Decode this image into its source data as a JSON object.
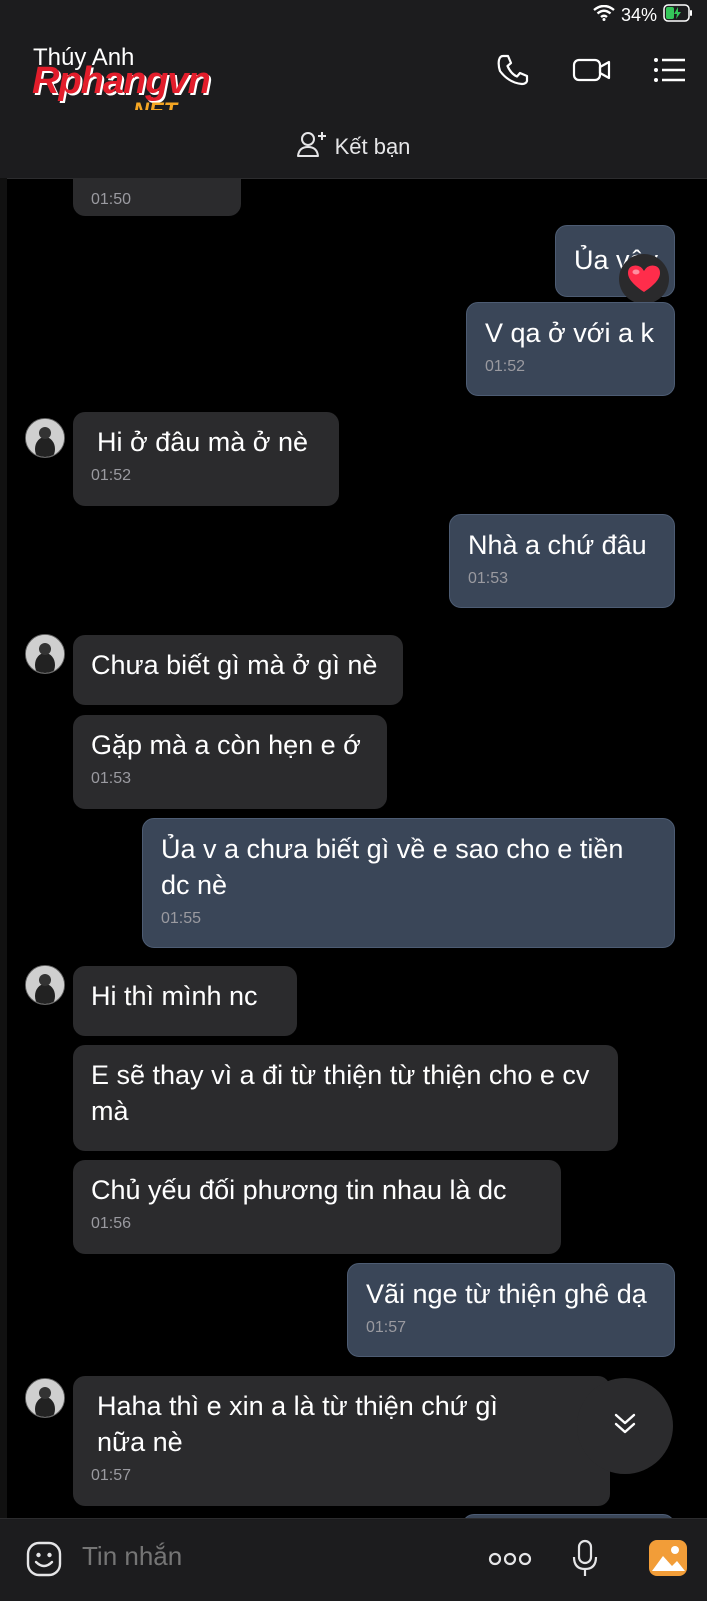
{
  "status": {
    "battery": "34%"
  },
  "header": {
    "contact_name": "Thúy Anh"
  },
  "watermark": {
    "main": "Rphangvn",
    "sub": ".NET"
  },
  "subheader": {
    "add_friend_label": "Kết bạn"
  },
  "messages": [
    {
      "dir": "in",
      "text": "",
      "time": "01:50"
    },
    {
      "dir": "out",
      "text": "Ủa vậy",
      "time": "",
      "reaction": "heart"
    },
    {
      "dir": "out",
      "text": "V qa ở với a k",
      "time": "01:52"
    },
    {
      "dir": "in",
      "text": "Hi ở đâu mà ở nè",
      "time": "01:52"
    },
    {
      "dir": "out",
      "text": "Nhà a chứ đâu",
      "time": "01:53"
    },
    {
      "dir": "in",
      "text": "Chưa biết gì mà ở gì nè",
      "time": ""
    },
    {
      "dir": "in",
      "text": "Gặp mà a còn hẹn e ớ",
      "time": "01:53"
    },
    {
      "dir": "out",
      "text": "Ủa v a chưa biết gì về e sao cho e tiền dc nè",
      "time": "01:55"
    },
    {
      "dir": "in",
      "text": "Hi thì mình nc",
      "time": ""
    },
    {
      "dir": "in",
      "text": "E sẽ thay vì a đi từ thiện từ thiện cho e cv mà",
      "time": ""
    },
    {
      "dir": "in",
      "text": "Chủ yếu đối phương tin nhau là dc",
      "time": "01:56"
    },
    {
      "dir": "out",
      "text": "Vãi nge từ thiện ghê dạ",
      "time": "01:57"
    },
    {
      "dir": "in",
      "text": "Haha thì e xin a là từ thiện chứ gì nữa nè",
      "time": "01:57"
    }
  ],
  "composer": {
    "placeholder": "Tin nhắn"
  },
  "colors": {
    "incoming_bubble": "#2b2b2d",
    "outgoing_bubble": "#3a4658",
    "background": "#000000",
    "watermark_red": "#e21d2b",
    "watermark_orange": "#f5a623",
    "battery_green": "#34c759",
    "gallery_orange": "#f29d38"
  },
  "icons": [
    "wifi-icon",
    "battery-icon",
    "phone-icon",
    "video-icon",
    "menu-icon",
    "add-friend-icon",
    "heart-icon",
    "chevron-down-icon",
    "sticker-icon",
    "more-icon",
    "mic-icon",
    "gallery-icon"
  ]
}
